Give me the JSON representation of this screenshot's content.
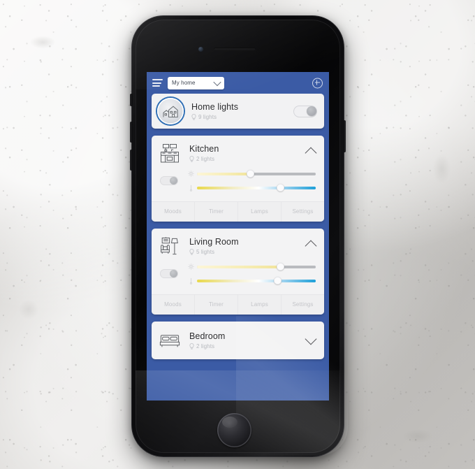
{
  "app": {
    "background_color": "#3b5ba5",
    "card_color": "#f3f3f4",
    "accent_color": "#2f6fb5"
  },
  "topbar": {
    "menu_icon": "hamburger-menu-icon",
    "home_selector": {
      "value": "My home",
      "chevron_icon": "chevron-down-icon"
    },
    "add_icon": "plus-circle-icon"
  },
  "home_lights": {
    "avatar_icon": "house-icon",
    "title": "Home lights",
    "bulb_icon": "lightbulb-icon",
    "lights_count_label": "9 lights",
    "toggle": {
      "state": "off"
    }
  },
  "tabs_labels": {
    "moods": "Moods",
    "timer": "Timer",
    "lamps": "Lamps",
    "settings": "Settings"
  },
  "rooms": [
    {
      "id": "kitchen",
      "icon": "kitchen-counter-icon",
      "title": "Kitchen",
      "bulb_icon": "lightbulb-icon",
      "lights_count_label": "2 lights",
      "expanded": true,
      "chevron_icon": "chevron-up-icon",
      "toggle": {
        "state": "off"
      },
      "brightness": {
        "icon": "brightness-sun-icon",
        "value": 45
      },
      "color_temp": {
        "icon": "color-temperature-icon",
        "value": 70
      },
      "tabs": [
        "Moods",
        "Timer",
        "Lamps",
        "Settings"
      ]
    },
    {
      "id": "living-room",
      "icon": "sofa-lamp-icon",
      "title": "Living Room",
      "bulb_icon": "lightbulb-icon",
      "lights_count_label": "5 lights",
      "expanded": true,
      "chevron_icon": "chevron-up-icon",
      "toggle": {
        "state": "off"
      },
      "brightness": {
        "icon": "brightness-sun-icon",
        "value": 70
      },
      "color_temp": {
        "icon": "color-temperature-icon",
        "value": 68
      },
      "tabs": [
        "Moods",
        "Timer",
        "Lamps",
        "Settings"
      ]
    },
    {
      "id": "bedroom",
      "icon": "bed-icon",
      "title": "Bedroom",
      "bulb_icon": "lightbulb-icon",
      "lights_count_label": "2 lights",
      "expanded": false,
      "chevron_icon": "chevron-down-icon"
    }
  ],
  "device": {
    "type": "smartphone",
    "color": "black",
    "home_button": "home-button",
    "earpiece": "earpiece-speaker",
    "camera": "front-camera"
  }
}
